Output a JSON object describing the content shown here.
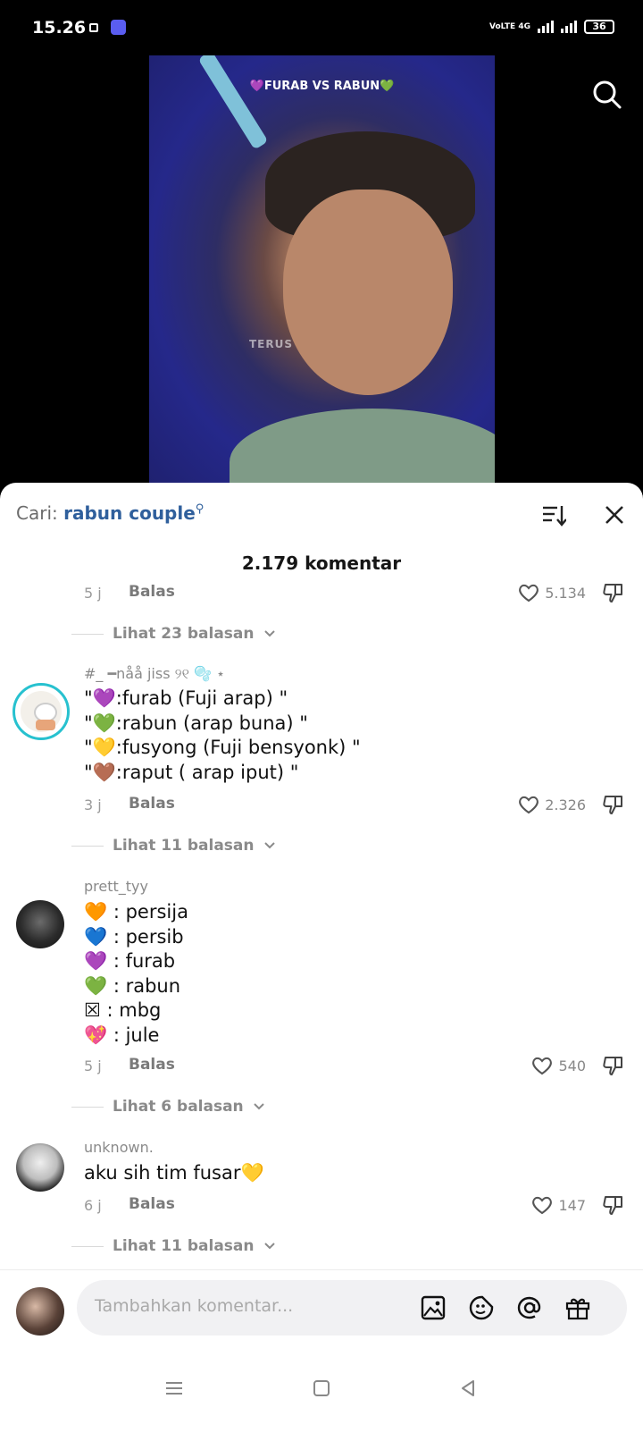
{
  "status_bar": {
    "time": "15.26",
    "network": "VoLTE 4G",
    "battery": "36"
  },
  "video": {
    "caption": "💜FURAB VS RABUN💚",
    "watermark": "TERUS"
  },
  "comments_panel": {
    "search_prefix": "Cari:",
    "search_keyword": "rabun couple",
    "count_label": "2.179 komentar",
    "reply_label": "Balas",
    "top_partial": {
      "time": "5 j",
      "likes": "5.134",
      "view_replies": "Lihat 23 balasan"
    },
    "comments": [
      {
        "username": "#_ ━nåå jiss ୨୧ 🫧 ⋆",
        "text": "\"💜:furab (Fuji arap) \"\n\"💚:rabun (arap buna) \"\n\"💛:fusyong (Fuji bensyonk) \"\n\"🤎:raput ( arap iput) \"",
        "time": "3 j",
        "likes": "2.326",
        "view_replies": "Lihat 11 balasan"
      },
      {
        "username": "prett_tyy",
        "text": "🧡 : persija\n💙 : persib\n💜 : furab\n💚 : rabun\n☒ : mbg\n💖 : jule",
        "time": "5 j",
        "likes": "540",
        "view_replies": "Lihat 6 balasan"
      },
      {
        "username": "unknown.",
        "text": "aku sih tim fusar💛",
        "time": "6 j",
        "likes": "147",
        "view_replies": "Lihat 11 balasan"
      }
    ],
    "input_placeholder": "Tambahkan komentar..."
  },
  "icons": {
    "search": "search-icon",
    "sort": "sort-icon",
    "close": "close-icon",
    "like": "heart-outline-icon",
    "dislike": "thumbs-down-icon",
    "chevron": "chevron-down-icon",
    "image": "image-icon",
    "emoji": "emoji-sticker-icon",
    "mention": "at-mention-icon",
    "gift": "gift-icon"
  },
  "colors": {
    "keyword_blue": "#2f5f9c",
    "avatar_ring": "#27c1cf",
    "battery_fill": "#e5c12d"
  }
}
